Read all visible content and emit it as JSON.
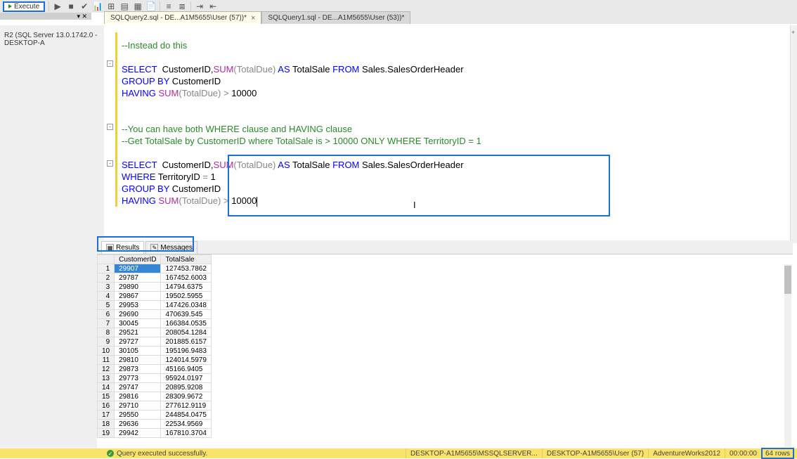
{
  "toolbar": {
    "execute_label": "Execute"
  },
  "sidebar": {
    "server_node": "R2 (SQL Server 13.0.1742.0 - DESKTOP-A"
  },
  "tabs": {
    "active": {
      "label": "SQLQuery2.sql - DE...A1M5655\\User (57))*"
    },
    "inactive": {
      "label": "SQLQuery1.sql - DE...A1M5655\\User (53))*"
    }
  },
  "code": {
    "l1": "--Instead do this",
    "l2_a": "SELECT",
    "l2_b": "  CustomerID,",
    "l2_c": "SUM",
    "l2_d": "(TotalDue)",
    "l2_e": " AS",
    "l2_f": " TotalSale",
    "l2_g": " FROM",
    "l2_h": " Sales.SalesOrderHeader",
    "l3_a": "GROUP BY",
    "l3_b": " CustomerID",
    "l4_a": "HAVING ",
    "l4_b": "SUM",
    "l4_c": "(TotalDue)",
    "l4_d": " > ",
    "l4_e": "10000",
    "l5": "--You can have both WHERE clause and HAVING clause",
    "l6": "--Get TotalSale by CustomerID where TotalSale is > 10000 ONLY WHERE TerritoryID = 1",
    "l7_a": "SELECT",
    "l7_b": "  CustomerID,",
    "l7_c": "SUM",
    "l7_d": "(TotalDue)",
    "l7_e": " AS",
    "l7_f": " TotalSale",
    "l7_g": " FROM",
    "l7_h": " Sales.SalesOrderHeader",
    "l8_a": "WHERE",
    "l8_b": " TerritoryID ",
    "l8_c": "=",
    "l8_d": " 1",
    "l9_a": "GROUP BY",
    "l9_b": " CustomerID",
    "l10_a": "HAVING ",
    "l10_b": "SUM",
    "l10_c": "(TotalDue)",
    "l10_d": " > ",
    "l10_e": "10000"
  },
  "results": {
    "tab_results": "Results",
    "tab_messages": "Messages",
    "columns": [
      "",
      "CustomerID",
      "TotalSale"
    ],
    "rows": [
      [
        "1",
        "29907",
        "127453.7862"
      ],
      [
        "2",
        "29787",
        "167452.6003"
      ],
      [
        "3",
        "29890",
        "14794.6375"
      ],
      [
        "4",
        "29867",
        "19502.5955"
      ],
      [
        "5",
        "29953",
        "147426.0348"
      ],
      [
        "6",
        "29690",
        "470639.545"
      ],
      [
        "7",
        "30045",
        "166384.0535"
      ],
      [
        "8",
        "29521",
        "208054.1284"
      ],
      [
        "9",
        "29727",
        "201885.6157"
      ],
      [
        "10",
        "30105",
        "195196.9483"
      ],
      [
        "11",
        "29810",
        "124014.5979"
      ],
      [
        "12",
        "29873",
        "45166.9405"
      ],
      [
        "13",
        "29773",
        "95924.0197"
      ],
      [
        "14",
        "29747",
        "20895.9208"
      ],
      [
        "15",
        "29816",
        "28309.9672"
      ],
      [
        "16",
        "29710",
        "277612.9119"
      ],
      [
        "17",
        "29550",
        "244854.0475"
      ],
      [
        "18",
        "29636",
        "22534.9569"
      ],
      [
        "19",
        "29942",
        "167810.3704"
      ]
    ]
  },
  "status": {
    "msg": "Query executed successfully.",
    "server": "DESKTOP-A1M5655\\MSSQLSERVER...",
    "user": "DESKTOP-A1M5655\\User (57)",
    "db": "AdventureWorks2012",
    "time": "00:00:00",
    "rows": "64 rows"
  }
}
